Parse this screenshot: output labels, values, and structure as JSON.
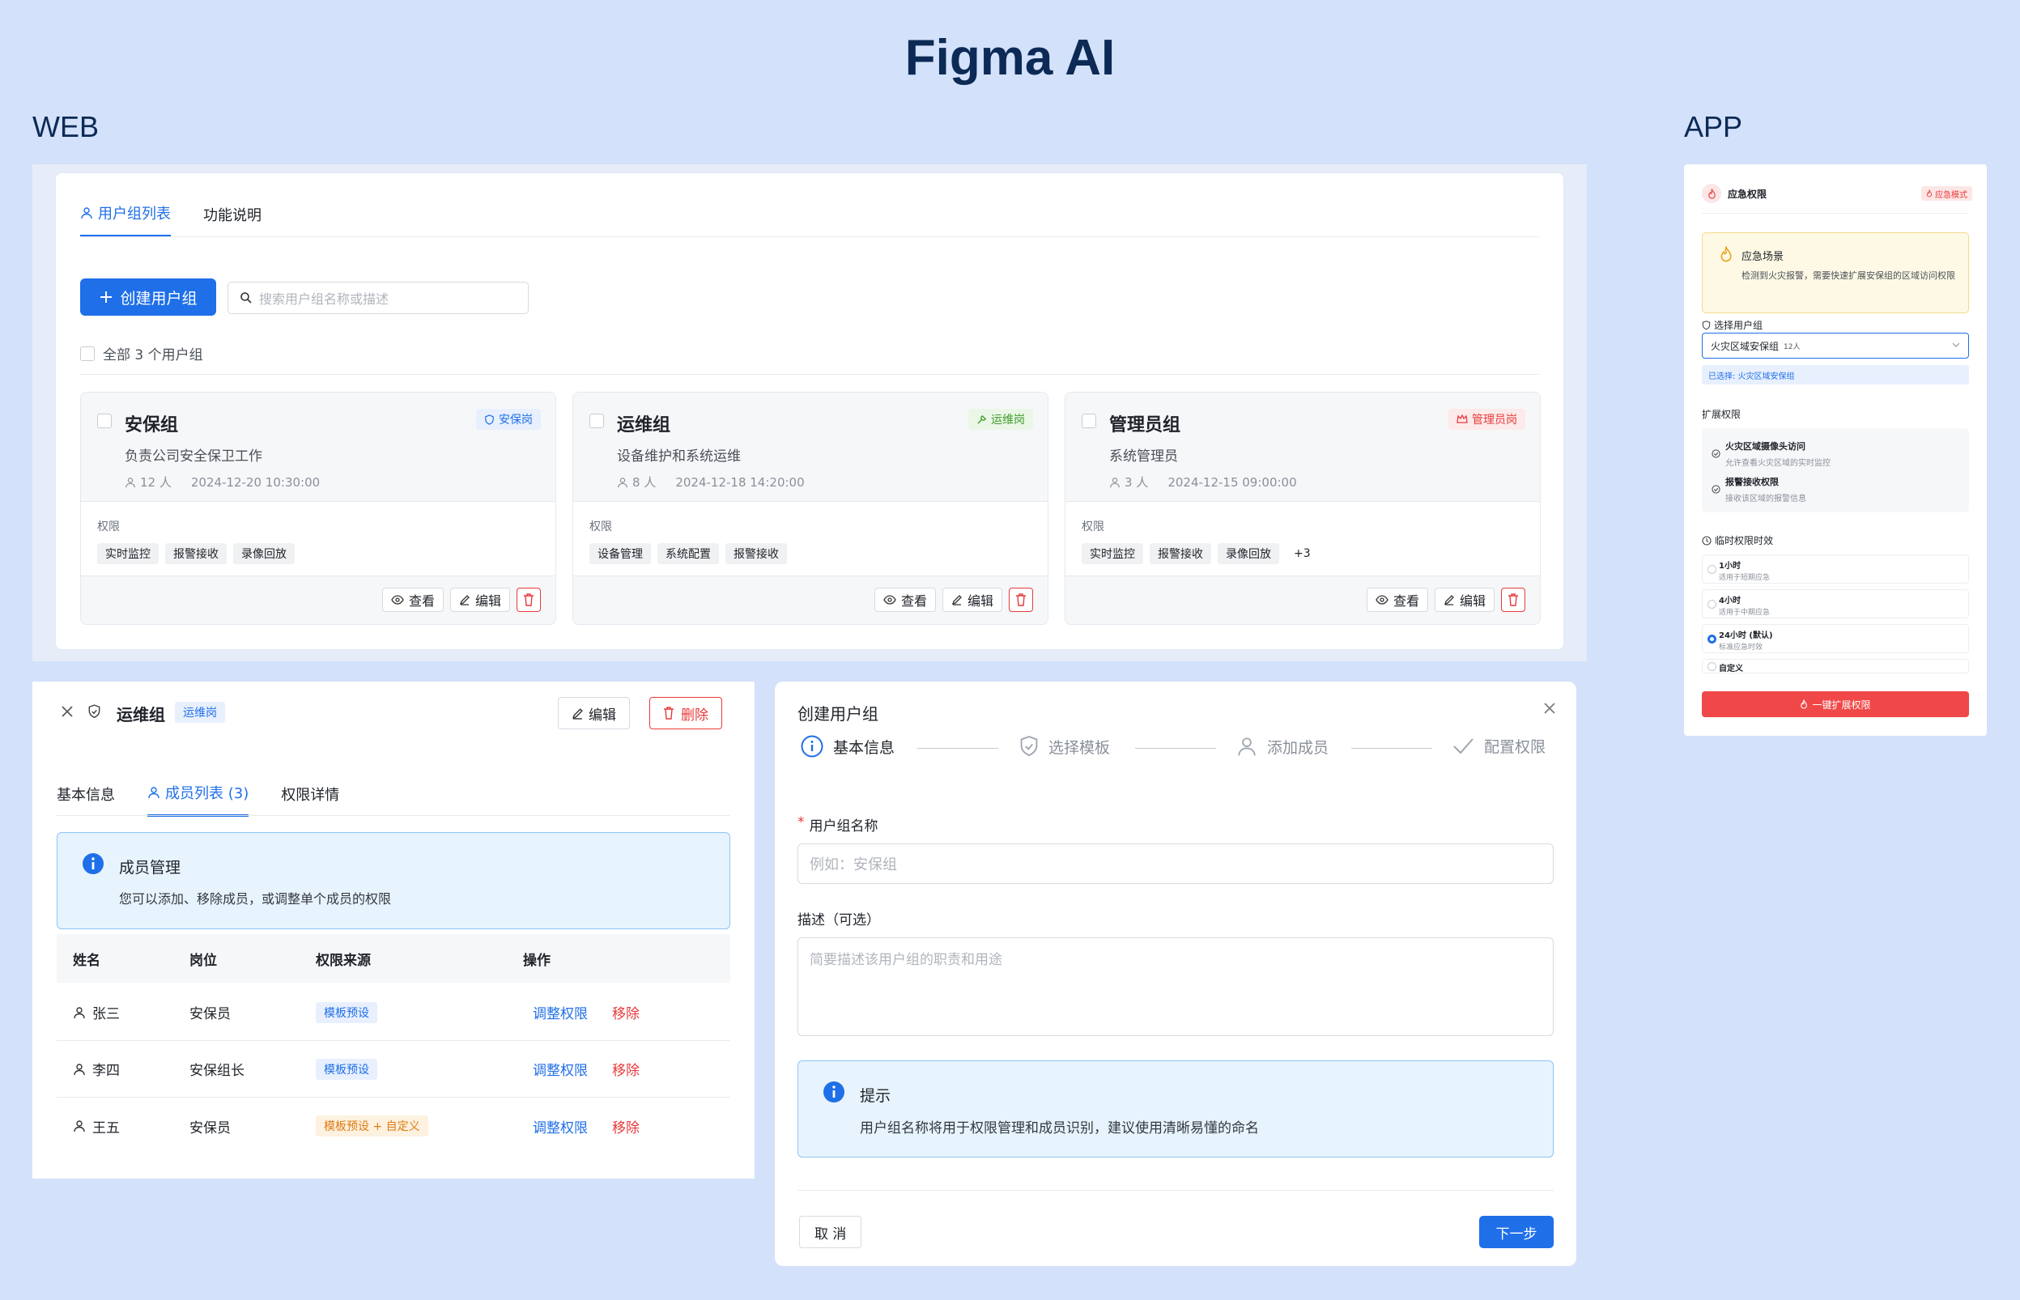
{
  "title": "Figma AI",
  "labels": {
    "web": "WEB",
    "app": "APP"
  },
  "colors": {
    "primary": "#1f6fe8",
    "danger": "#e83a3a",
    "bg": "#d3e1fa"
  },
  "web": {
    "tabs": [
      "用户组列表",
      "功能说明"
    ],
    "create_button": "创建用户组",
    "search_placeholder": "搜索用户组名称或描述",
    "select_all": "全部 3 个用户组",
    "perm_label": "权限",
    "actions": {
      "view": "查看",
      "edit": "编辑"
    },
    "groups": [
      {
        "name": "安保组",
        "badge": "安保岗",
        "desc": "负责公司安全保卫工作",
        "members": "12 人",
        "time": "2024-12-20 10:30:00",
        "perms": [
          "实时监控",
          "报警接收",
          "录像回放"
        ]
      },
      {
        "name": "运维组",
        "badge": "运维岗",
        "desc": "设备维护和系统运维",
        "members": "8 人",
        "time": "2024-12-18 14:20:00",
        "perms": [
          "设备管理",
          "系统配置",
          "报警接收"
        ]
      },
      {
        "name": "管理员组",
        "badge": "管理员岗",
        "desc": "系统管理员",
        "members": "3 人",
        "time": "2024-12-15 09:00:00",
        "perms": [
          "实时监控",
          "报警接收",
          "录像回放",
          "+3"
        ]
      }
    ]
  },
  "detail": {
    "title": "运维组",
    "badge": "运维岗",
    "edit": "编辑",
    "delete": "删除",
    "tabs": [
      "基本信息",
      "成员列表 (3)",
      "权限详情"
    ],
    "info_title": "成员管理",
    "info_text": "您可以添加、移除成员，或调整单个成员的权限",
    "columns": [
      "姓名",
      "岗位",
      "权限来源",
      "操作"
    ],
    "rows": [
      {
        "name": "张三",
        "post": "安保员",
        "source": "模板预设",
        "adjust": "调整权限",
        "remove": "移除"
      },
      {
        "name": "李四",
        "post": "安保组长",
        "source": "模板预设",
        "adjust": "调整权限",
        "remove": "移除"
      },
      {
        "name": "王五",
        "post": "安保员",
        "source": "模板预设 + 自定义",
        "adjust": "调整权限",
        "remove": "移除"
      }
    ]
  },
  "create": {
    "title": "创建用户组",
    "steps": [
      "基本信息",
      "选择模板",
      "添加成员",
      "配置权限"
    ],
    "name_required": "*",
    "name_label": "用户组名称",
    "name_placeholder": "例如：安保组",
    "desc_label": "描述（可选）",
    "desc_placeholder": "简要描述该用户组的职责和用途",
    "tip_title": "提示",
    "tip_text": "用户组名称将用于权限管理和成员识别，建议使用清晰易懂的命名",
    "cancel": "取 消",
    "next": "下一步"
  },
  "app": {
    "header": "应急权限",
    "mode_badge": "应急模式",
    "scene_title": "应急场景",
    "scene_text": "检测到火灾报警，需要快速扩展安保组的区域访问权限",
    "select_group_label": "选择用户组",
    "selected_group": "火灾区域安保组",
    "selected_count": "12人",
    "selected_hint": "已选择: 火灾区域安保组",
    "extend_label": "扩展权限",
    "extend_items": [
      {
        "title": "火灾区域摄像头访问",
        "desc": "允许查看火灾区域的实时监控"
      },
      {
        "title": "报警接收权限",
        "desc": "接收该区域的报警信息"
      }
    ],
    "duration_label": "临时权限时效",
    "durations": [
      {
        "title": "1小时",
        "desc": "适用于短期应急"
      },
      {
        "title": "4小时",
        "desc": "适用于中期应急"
      },
      {
        "title": "24小时 (默认)",
        "desc": "标准应急时效"
      },
      {
        "title": "自定义",
        "desc": ""
      }
    ],
    "submit": "一键扩展权限"
  }
}
